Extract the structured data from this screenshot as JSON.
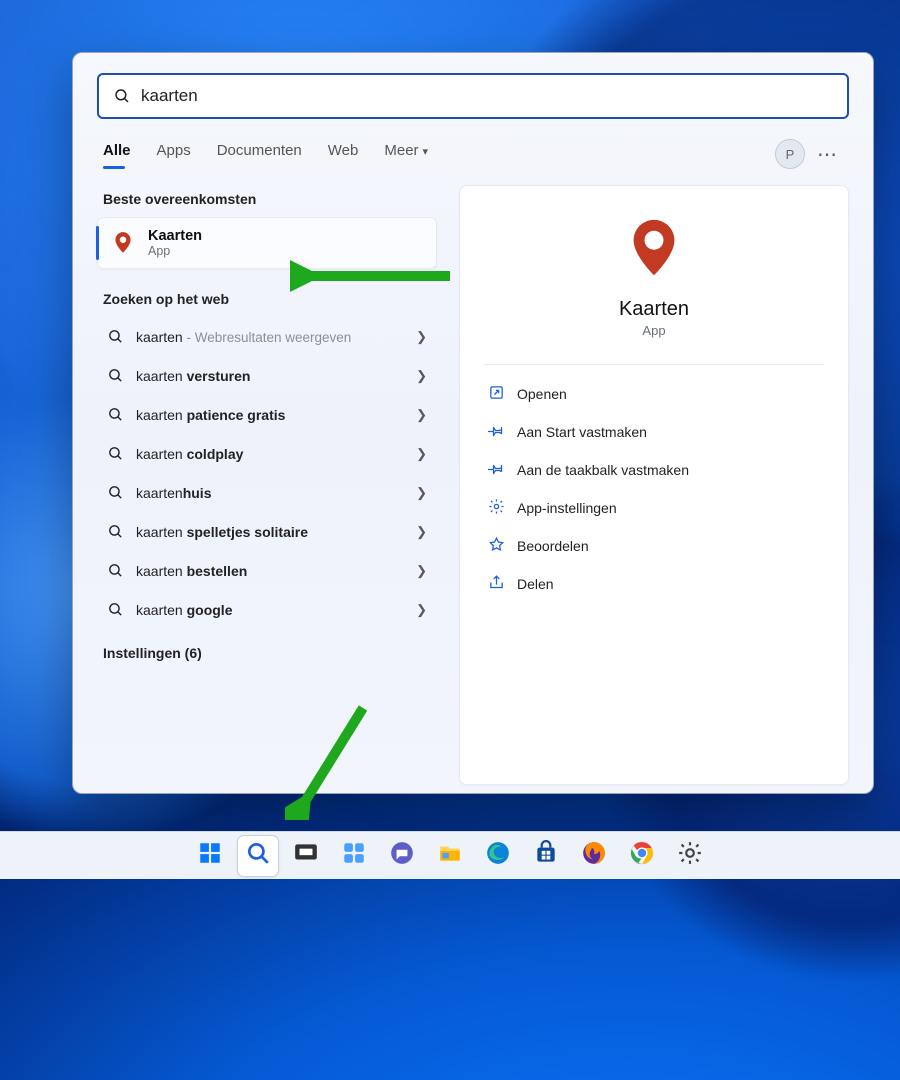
{
  "search": {
    "value": "kaarten"
  },
  "tabs": [
    "Alle",
    "Apps",
    "Documenten",
    "Web",
    "Meer"
  ],
  "active_tab_index": 0,
  "user_initial": "P",
  "left": {
    "best_match_label": "Beste overeenkomsten",
    "best_match": {
      "title": "Kaarten",
      "subtitle": "App"
    },
    "web_label": "Zoeken op het web",
    "web_items": [
      {
        "prefix": "kaarten",
        "bold": "",
        "hint": " - Webresultaten weergeven"
      },
      {
        "prefix": "kaarten ",
        "bold": "versturen",
        "hint": ""
      },
      {
        "prefix": "kaarten ",
        "bold": "patience gratis",
        "hint": ""
      },
      {
        "prefix": "kaarten ",
        "bold": "coldplay",
        "hint": ""
      },
      {
        "prefix": "kaarten",
        "bold": "huis",
        "hint": ""
      },
      {
        "prefix": "kaarten ",
        "bold": "spelletjes solitaire",
        "hint": ""
      },
      {
        "prefix": "kaarten ",
        "bold": "bestellen",
        "hint": ""
      },
      {
        "prefix": "kaarten ",
        "bold": "google",
        "hint": ""
      }
    ],
    "settings_label": "Instellingen (6)"
  },
  "detail": {
    "title": "Kaarten",
    "subtitle": "App",
    "actions": [
      {
        "icon": "open",
        "label": "Openen"
      },
      {
        "icon": "pin",
        "label": "Aan Start vastmaken"
      },
      {
        "icon": "pin",
        "label": "Aan de taakbalk vastmaken"
      },
      {
        "icon": "gear",
        "label": "App-instellingen"
      },
      {
        "icon": "star",
        "label": "Beoordelen"
      },
      {
        "icon": "share",
        "label": "Delen"
      }
    ]
  },
  "taskbar": {
    "items": [
      "start",
      "search",
      "taskview",
      "widgets",
      "chat",
      "explorer",
      "edge",
      "store",
      "firefox",
      "chrome",
      "settings"
    ],
    "active": "search"
  }
}
